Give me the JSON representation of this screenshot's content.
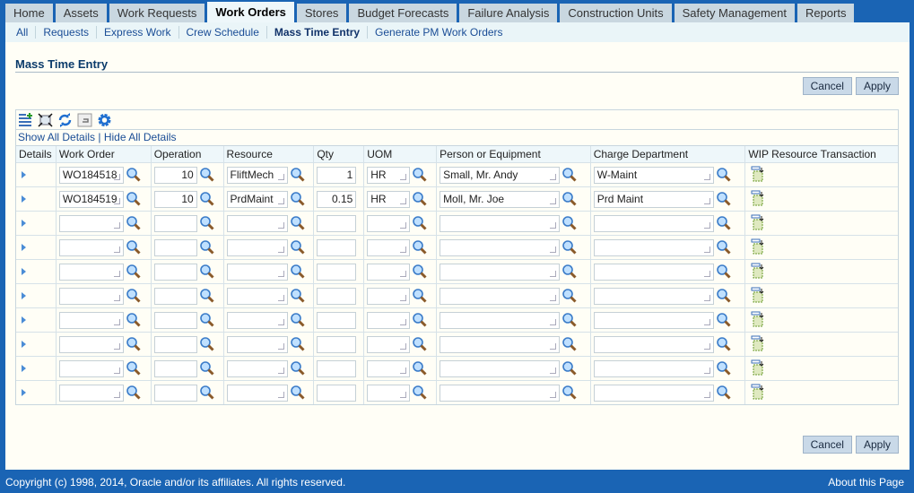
{
  "tabs": [
    "Home",
    "Assets",
    "Work Requests",
    "Work Orders",
    "Stores",
    "Budget Forecasts",
    "Failure Analysis",
    "Construction Units",
    "Safety Management",
    "Reports"
  ],
  "active_tab": "Work Orders",
  "subnav": [
    "All",
    "Requests",
    "Express Work",
    "Crew Schedule",
    "Mass Time Entry",
    "Generate PM Work Orders"
  ],
  "active_subnav": "Mass Time Entry",
  "page_title": "Mass Time Entry",
  "buttons": {
    "cancel": "Cancel",
    "apply": "Apply"
  },
  "toolbar_icons": [
    "add-rows-icon",
    "detach-table-icon",
    "refresh-icon",
    "revert-icon",
    "settings-icon"
  ],
  "details_links": {
    "show": "Show All Details",
    "sep": " | ",
    "hide": "Hide All Details"
  },
  "columns": [
    "Details",
    "Work Order",
    "Operation",
    "Resource",
    "Qty",
    "UOM",
    "Person or Equipment",
    "Charge Department",
    "WIP Resource Transaction"
  ],
  "rows": [
    {
      "work_order": "WO184518",
      "operation": "10",
      "resource": "FliftMech",
      "qty": "1",
      "uom": "HR",
      "person": "Small, Mr. Andy",
      "department": "W-Maint"
    },
    {
      "work_order": "WO184519",
      "operation": "10",
      "resource": "PrdMaint",
      "qty": "0.15",
      "uom": "HR",
      "person": "Moll, Mr. Joe",
      "department": "Prd Maint"
    },
    {},
    {},
    {},
    {},
    {},
    {},
    {},
    {}
  ],
  "footer": {
    "copyright": "Copyright (c) 1998, 2014, Oracle and/or its affiliates. All rights reserved.",
    "about": "About this Page"
  },
  "colors": {
    "frame": "#1a64b4",
    "background": "#fffef6",
    "link": "#1a4d96"
  }
}
